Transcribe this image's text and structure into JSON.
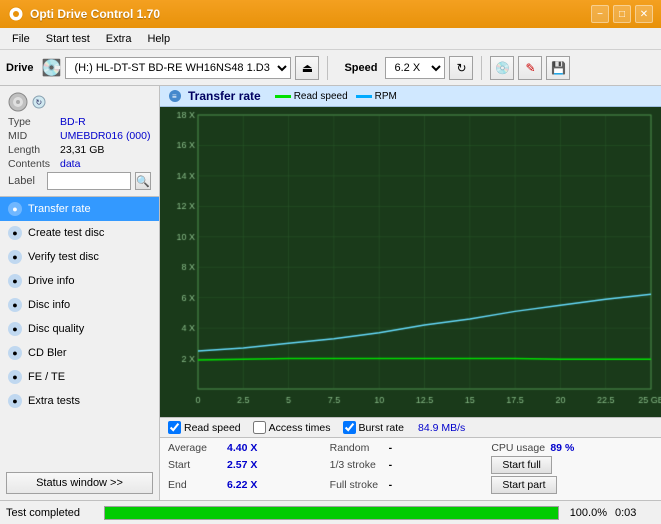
{
  "titlebar": {
    "title": "Opti Drive Control 1.70",
    "minimize": "−",
    "maximize": "□",
    "close": "✕"
  },
  "menubar": {
    "items": [
      "File",
      "Start test",
      "Extra",
      "Help"
    ]
  },
  "toolbar": {
    "drive_label": "Drive",
    "drive_value": "(H:)  HL-DT-ST BD-RE  WH16NS48 1.D3",
    "speed_label": "Speed",
    "speed_value": "6.2 X"
  },
  "disc": {
    "type_key": "Type",
    "type_val": "BD-R",
    "mid_key": "MID",
    "mid_val": "UMEBDR016 (000)",
    "length_key": "Length",
    "length_val": "23,31 GB",
    "contents_key": "Contents",
    "contents_val": "data",
    "label_key": "Label",
    "label_placeholder": ""
  },
  "nav": {
    "items": [
      {
        "id": "transfer-rate",
        "label": "Transfer rate",
        "active": true
      },
      {
        "id": "create-test-disc",
        "label": "Create test disc",
        "active": false
      },
      {
        "id": "verify-test-disc",
        "label": "Verify test disc",
        "active": false
      },
      {
        "id": "drive-info",
        "label": "Drive info",
        "active": false
      },
      {
        "id": "disc-info",
        "label": "Disc info",
        "active": false
      },
      {
        "id": "disc-quality",
        "label": "Disc quality",
        "active": false
      },
      {
        "id": "cd-bler",
        "label": "CD Bler",
        "active": false
      },
      {
        "id": "fe-te",
        "label": "FE / TE",
        "active": false
      },
      {
        "id": "extra-tests",
        "label": "Extra tests",
        "active": false
      }
    ],
    "status_btn": "Status window >>"
  },
  "chart": {
    "title": "Transfer rate",
    "legend": {
      "read_speed_label": "Read speed",
      "rpm_label": "RPM",
      "read_color": "#00e000",
      "rpm_color": "#00aaff"
    },
    "y_labels": [
      "18 X",
      "16 X",
      "14 X",
      "12 X",
      "10 X",
      "8 X",
      "6 X",
      "4 X",
      "2 X"
    ],
    "x_labels": [
      "0.0",
      "2.5",
      "5.0",
      "7.5",
      "10.0",
      "12.5",
      "15.0",
      "17.5",
      "20.0",
      "22.5",
      "25.0 GB"
    ],
    "checkboxes": [
      {
        "label": "Read speed",
        "checked": true
      },
      {
        "label": "Access times",
        "checked": false
      },
      {
        "label": "Burst rate",
        "checked": true
      }
    ],
    "burst_rate": "84.9 MB/s"
  },
  "stats": {
    "rows": [
      {
        "col1_key": "Average",
        "col1_val": "4.40 X",
        "col2_key": "Random",
        "col2_val": "-",
        "col3_key": "CPU usage",
        "col3_val": "89 %"
      },
      {
        "col1_key": "Start",
        "col1_val": "2.57 X",
        "col2_key": "1/3 stroke",
        "col2_val": "-",
        "col3_btn": "Start full"
      },
      {
        "col1_key": "End",
        "col1_val": "6.22 X",
        "col2_key": "Full stroke",
        "col2_val": "-",
        "col3_btn": "Start part"
      }
    ]
  },
  "statusbar": {
    "text": "Test completed",
    "progress": 100,
    "time": "0:03"
  }
}
